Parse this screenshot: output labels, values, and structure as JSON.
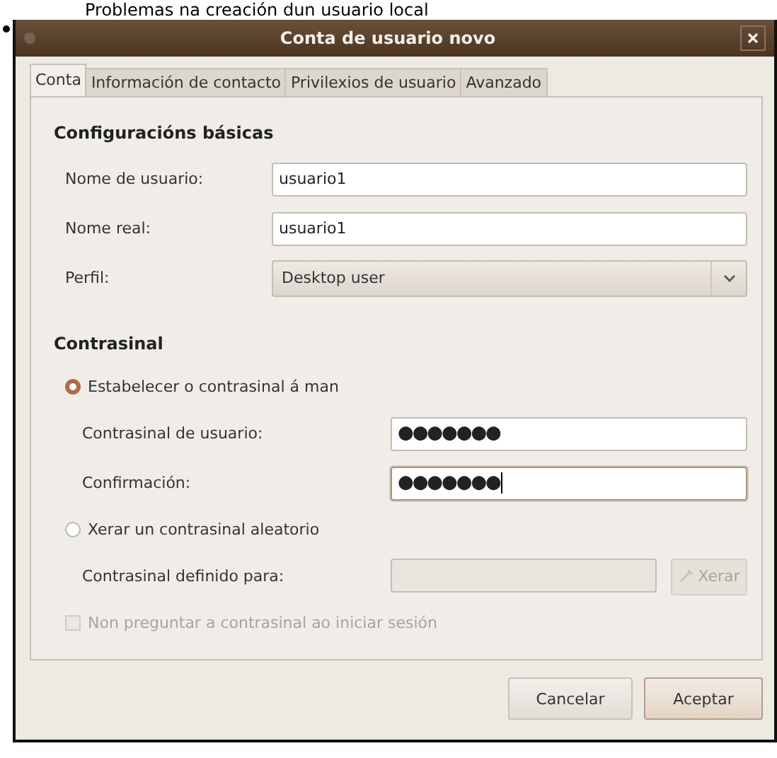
{
  "caption": "Problemas na creación dun usuario local",
  "window": {
    "title": "Conta de usuario novo"
  },
  "tabs": [
    {
      "label": "Conta",
      "selected": true
    },
    {
      "label": "Información de contacto",
      "selected": false
    },
    {
      "label": "Privilexios de usuario",
      "selected": false
    },
    {
      "label": "Avanzado",
      "selected": false
    }
  ],
  "basic": {
    "heading": "Configuracións básicas",
    "fields": [
      {
        "kind": "entry",
        "label": "Nome de usuario:",
        "value": "usuario1"
      },
      {
        "kind": "entry",
        "label": "Nome real:",
        "value": "usuario1"
      },
      {
        "kind": "combo",
        "label": "Perfil:",
        "value": "Desktop user"
      }
    ]
  },
  "password": {
    "heading": "Contrasinal",
    "manual": {
      "label": "Estabelecer o contrasinal á man",
      "selected": true,
      "fields": [
        {
          "label": "Contrasinal de usuario:",
          "value": "●●●●●●●",
          "focused": false
        },
        {
          "label": "Confirmación:",
          "value": "●●●●●●●",
          "focused": true
        }
      ]
    },
    "random": {
      "label": "Xerar un contrasinal aleatorio",
      "selected": false,
      "field_label": "Contrasinal definido para:",
      "button": "Xerar",
      "disabled": true
    },
    "no_ask": {
      "label": "Non preguntar a contrasinal ao iniciar sesión",
      "checked": false,
      "disabled": true
    }
  },
  "buttons": [
    {
      "label": "Cancelar",
      "default": false
    },
    {
      "label": "Aceptar",
      "default": true
    }
  ]
}
